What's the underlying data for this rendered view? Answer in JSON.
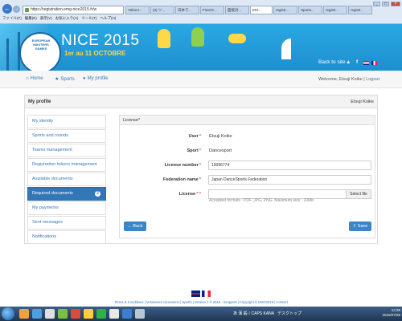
{
  "browser": {
    "back_icon": "back-arrow-icon",
    "address": "https://registration.emg-nice2015.fr/w",
    "tabs": [
      "Yahoo!...",
      "(3) ツ...",
      "日本で...",
      "Final E...",
      "面接対...",
      "EM...",
      "registr...",
      "Sports...",
      "registr...",
      "registr..."
    ],
    "menu": [
      "ファイル(F)",
      "編集(E)",
      "表示(V)",
      "お気に入り(A)",
      "ツール(T)",
      "ヘルプ(H)"
    ]
  },
  "banner": {
    "logo_text": "EUROPEAN MASTERS GAMES",
    "title": "NICE 2015",
    "dates": "1er au 11 OCTOBRE",
    "back_to_site": "Back to site"
  },
  "nav": {
    "home": "Home",
    "sports": "Sports",
    "profile": "My profile",
    "welcome": "Welcome, Etsuji Koike",
    "logout": "Logout"
  },
  "panel": {
    "title": "My profile",
    "user_name": "Etsuji Koike"
  },
  "sidebar": {
    "items": [
      {
        "label": "My identity"
      },
      {
        "label": "Sports and rounds"
      },
      {
        "label": "Teams management"
      },
      {
        "label": "Registration tokens management"
      },
      {
        "label": "Available documents"
      },
      {
        "label": "Required documents",
        "badge": "2"
      },
      {
        "label": "My payments"
      },
      {
        "label": "Sent messages"
      },
      {
        "label": "Notifications"
      }
    ]
  },
  "form": {
    "header": "License*",
    "user_label": "User",
    "user_value": "Etsuji Koike",
    "sport_label": "Sport",
    "sport_value": "Dancesport",
    "license_label": "License number",
    "license_value": "10096774",
    "federation_label": "Federation name",
    "federation_value": "Japan DanceSports Federation",
    "file_label": "License",
    "select_file": "Select file",
    "hint": "Accepted formats : PDF, JPG, PNG. Maximum size : 10Mb",
    "back_button": "Back",
    "save_button": "Save"
  },
  "footer": {
    "links": "Terms & Conditions | Volunteers convention | Sports | Version 1 © 2015 - inrapport | Copyright © EMG2015 | Contact"
  },
  "taskbar": {
    "ime": "あ 漢 般 ⟨ CAPS KANA",
    "desktop": "デスクトップ",
    "time": "13:39",
    "date": "2015/07/28"
  },
  "colors": {
    "accent": "#3277b8",
    "banner": "#1e8fd0",
    "required": "#d9534f"
  }
}
